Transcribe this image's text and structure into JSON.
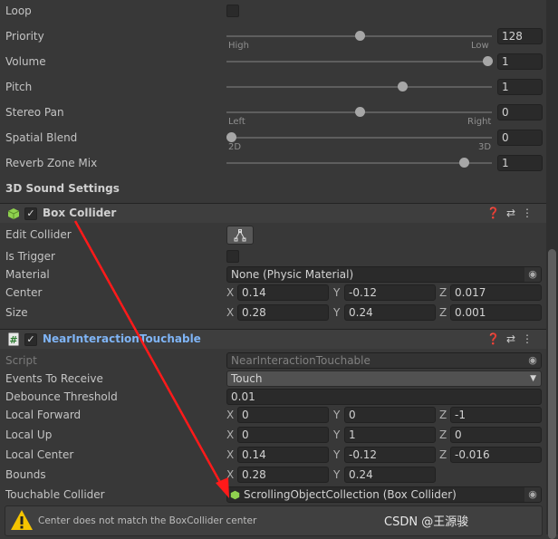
{
  "audio": {
    "loop": {
      "label": "Loop",
      "checked": false
    },
    "priority": {
      "label": "Priority",
      "value": "128",
      "fraction": 0.5,
      "min_label": "High",
      "max_label": "Low"
    },
    "volume": {
      "label": "Volume",
      "value": "1",
      "fraction": 1.0
    },
    "pitch": {
      "label": "Pitch",
      "value": "1",
      "fraction": 0.667
    },
    "stereo_pan": {
      "label": "Stereo Pan",
      "value": "0",
      "fraction": 0.5,
      "min_label": "Left",
      "max_label": "Right"
    },
    "spatial_blend": {
      "label": "Spatial Blend",
      "value": "0",
      "fraction": 0.0,
      "min_label": "2D",
      "max_label": "3D"
    },
    "reverb_zone_mix": {
      "label": "Reverb Zone Mix",
      "value": "1",
      "fraction": 0.909
    },
    "sound_3d": "3D Sound Settings"
  },
  "box_collider": {
    "title": "Box Collider",
    "enabled": true,
    "icon": "cube-icon",
    "edit_collider": "Edit Collider",
    "is_trigger": "Is Trigger",
    "material": {
      "label": "Material",
      "value": "None (Physic Material)"
    },
    "center": {
      "label": "Center",
      "x": "0.14",
      "y": "-0.12",
      "z": "0.017"
    },
    "size": {
      "label": "Size",
      "x": "0.28",
      "y": "0.24",
      "z": "0.001"
    }
  },
  "touchable": {
    "title": "NearInteractionTouchable",
    "enabled": true,
    "icon": "script-hash-icon",
    "script": {
      "label": "Script",
      "value": "NearInteractionTouchable"
    },
    "events": {
      "label": "Events To Receive",
      "value": "Touch"
    },
    "debounce": {
      "label": "Debounce Threshold",
      "value": "0.01"
    },
    "local_forward": {
      "label": "Local Forward",
      "x": "0",
      "y": "0",
      "z": "-1"
    },
    "local_up": {
      "label": "Local Up",
      "x": "0",
      "y": "1",
      "z": "0"
    },
    "local_center": {
      "label": "Local Center",
      "x": "0.14",
      "y": "-0.12",
      "z": "-0.016"
    },
    "bounds": {
      "label": "Bounds",
      "x": "0.28",
      "y": "0.24"
    },
    "collider": {
      "label": "Touchable Collider",
      "value": "ScrollingObjectCollection (Box Collider)"
    },
    "warning": "Center does not match the BoxCollider center"
  },
  "axes": {
    "x": "X",
    "y": "Y",
    "z": "Z"
  },
  "watermark": "CSDN @王源骏",
  "colors": {
    "accent_link": "#7fb4f5",
    "arrow": "#ff1a1a",
    "cube": "#8fd14f",
    "warning": "#f5c400"
  }
}
